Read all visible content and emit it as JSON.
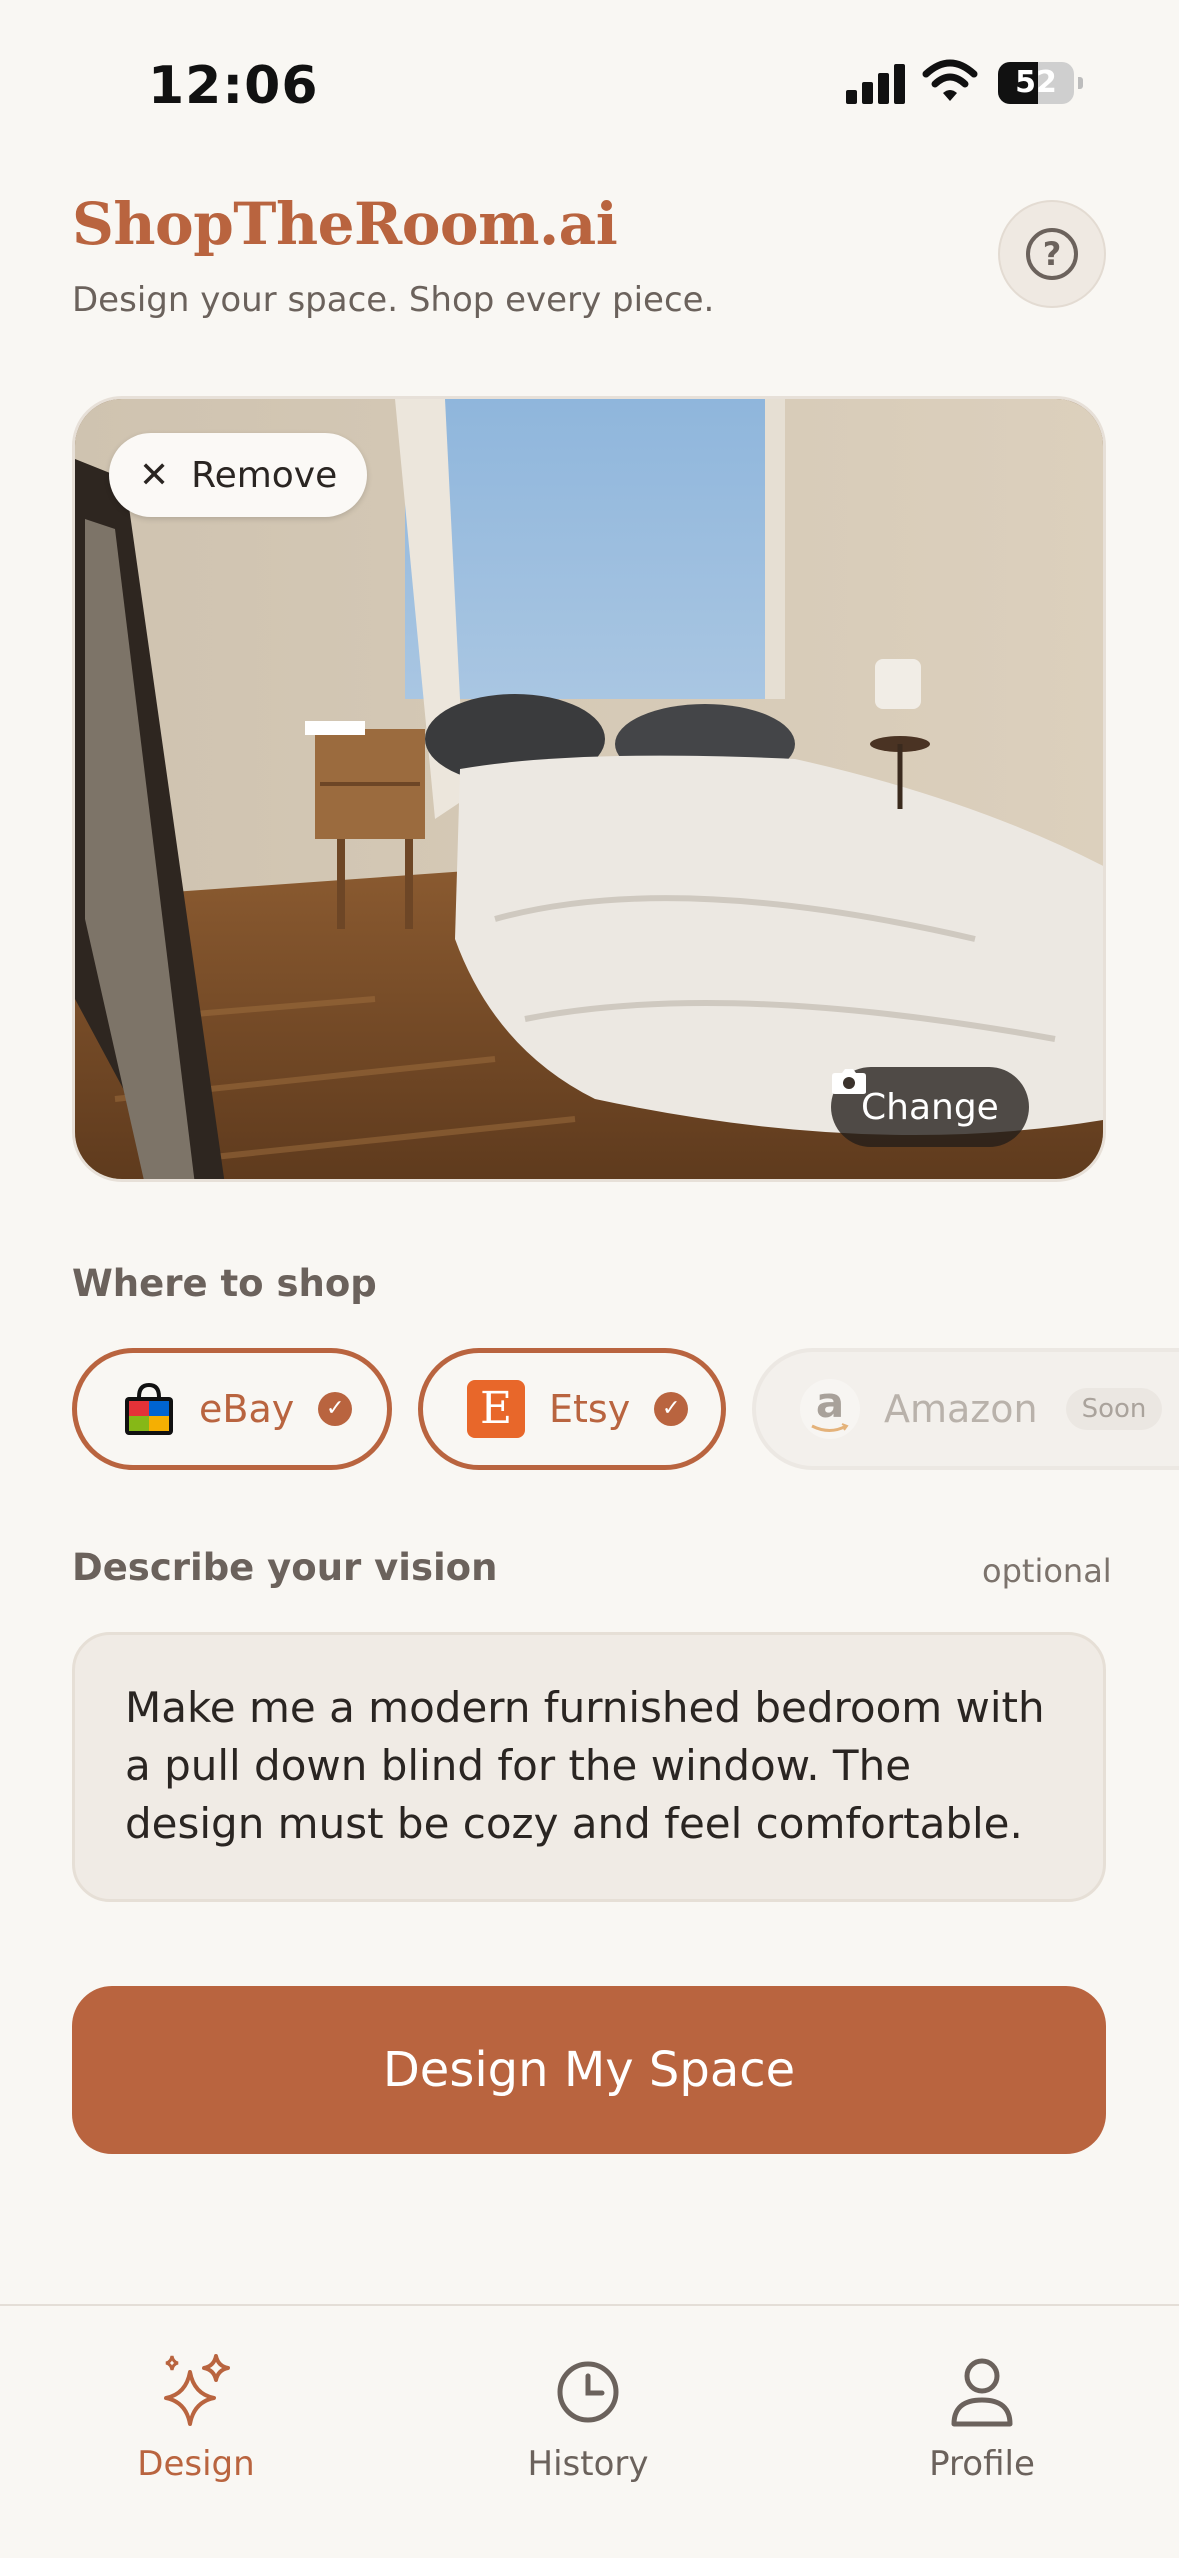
{
  "status": {
    "time": "12:06",
    "battery": "52",
    "battery_level": 0.52
  },
  "header": {
    "brand": "ShopTheRoom.ai",
    "tagline": "Design your space. Shop every piece.",
    "help_icon": "question-circle-icon"
  },
  "photo": {
    "remove_label": "Remove",
    "change_label": "Change"
  },
  "shop": {
    "label": "Where to shop",
    "options": [
      {
        "label": "eBay",
        "selected": true,
        "icon": "ebay-bag-icon"
      },
      {
        "label": "Etsy",
        "selected": true,
        "icon": "etsy-logo-icon",
        "glyph": "E"
      },
      {
        "label": "Amazon",
        "selected": false,
        "icon": "amazon-logo-icon",
        "glyph": "a",
        "badge": "Soon"
      }
    ]
  },
  "vision": {
    "label": "Describe your vision",
    "optional": "optional",
    "text": "Make me a modern furnished bedroom with a pull down blind for the window. The design must be cozy and feel comfortable."
  },
  "cta": {
    "label": "Design My Space"
  },
  "tabs": [
    {
      "label": "Design",
      "icon": "sparkles-icon",
      "active": true
    },
    {
      "label": "History",
      "icon": "clock-icon",
      "active": false
    },
    {
      "label": "Profile",
      "icon": "person-icon",
      "active": false
    }
  ],
  "colors": {
    "accent": "#b9643f",
    "background": "#f9f7f3",
    "text": "#2a2522",
    "muted": "#6b625c"
  }
}
